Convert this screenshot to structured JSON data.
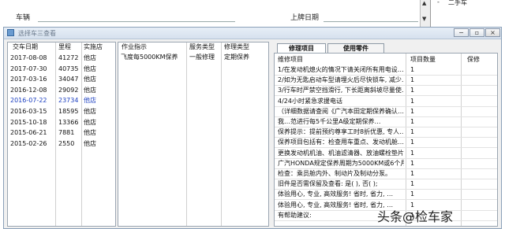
{
  "background": {
    "car_label": "车辆",
    "date_label": "上牌日期",
    "tree_item": "二手车",
    "tree_expander": "-"
  },
  "dialog": {
    "title": "选择车三查看",
    "minimize": "−",
    "maximize": "▫",
    "close": "×"
  },
  "history": {
    "headers": [
      "交车日期",
      "里程",
      "实施店"
    ],
    "rows": [
      {
        "date": "2017-08-08",
        "mileage": "41272",
        "store": "他店"
      },
      {
        "date": "2017-07-30",
        "mileage": "40735",
        "store": "他店"
      },
      {
        "date": "2017-03-16",
        "mileage": "34047",
        "store": "他店"
      },
      {
        "date": "2016-12-08",
        "mileage": "29092",
        "store": "他店"
      },
      {
        "date": "2016-07-22",
        "mileage": "23734",
        "store": "他店",
        "selected": true
      },
      {
        "date": "2016-03-15",
        "mileage": "18595",
        "store": "他店"
      },
      {
        "date": "2015-10-18",
        "mileage": "13366",
        "store": "他店"
      },
      {
        "date": "2015-06-21",
        "mileage": "7881",
        "store": "他店"
      },
      {
        "date": "2015-02-26",
        "mileage": "2550",
        "store": "他店"
      }
    ]
  },
  "work": {
    "headers": [
      "作业指示",
      "服务类型",
      "修理类型"
    ],
    "rows": [
      {
        "instruction": "飞度每5000KM保养",
        "service": "一般修理",
        "repair": "定期保养"
      }
    ]
  },
  "tabs": [
    "修理项目",
    "使用零件"
  ],
  "items": {
    "headers": [
      "维修项目",
      "项目数量",
      "保修"
    ],
    "rows": [
      {
        "name": "1/在发动机熄火的情况下请关闭所有用电设…",
        "qty": "1"
      },
      {
        "name": "2/如为无匙启动车型请埋火后尽快锁车, 减少…",
        "qty": "1"
      },
      {
        "name": "3/行车时严禁空挡滑行, 下长距离斜坡尽量使…",
        "qty": "1"
      },
      {
        "name": "4/24小时紧急求援电话",
        "qty": "1"
      },
      {
        "name": "（详细数据请查阅《广汽本田定期保养确认…",
        "qty": "1"
      },
      {
        "name": "我…范进行每5千公里A级定期保养…",
        "qty": "1"
      },
      {
        "name": "保养提示：提前预约尊享工时8折优惠, 专人…",
        "qty": "1"
      },
      {
        "name": "保养项目包括有：检查用车重点、发动机舱…",
        "qty": "1"
      },
      {
        "name": "更换发动机机油、机油滤清器、放油螺栓垫片",
        "qty": "1"
      },
      {
        "name": "广汽HONDA规定保养周期为5000KM或6个月, 以…",
        "qty": "1"
      },
      {
        "name": "检查：乘员舱内外、制动片及制动分泵。",
        "qty": "1"
      },
      {
        "name": "旧件是否需保留及查看: 是(  ), 否(  );",
        "qty": "1"
      },
      {
        "name": "体验用心, 专业, 高效服务! 省时, 省力, …",
        "qty": "1"
      },
      {
        "name": "体验用心, 专业, 高效服务! 省时, 省力, …",
        "qty": "1"
      },
      {
        "name": "有帮助建议:",
        "qty": "1"
      }
    ]
  },
  "watermark": "头条@检车家"
}
